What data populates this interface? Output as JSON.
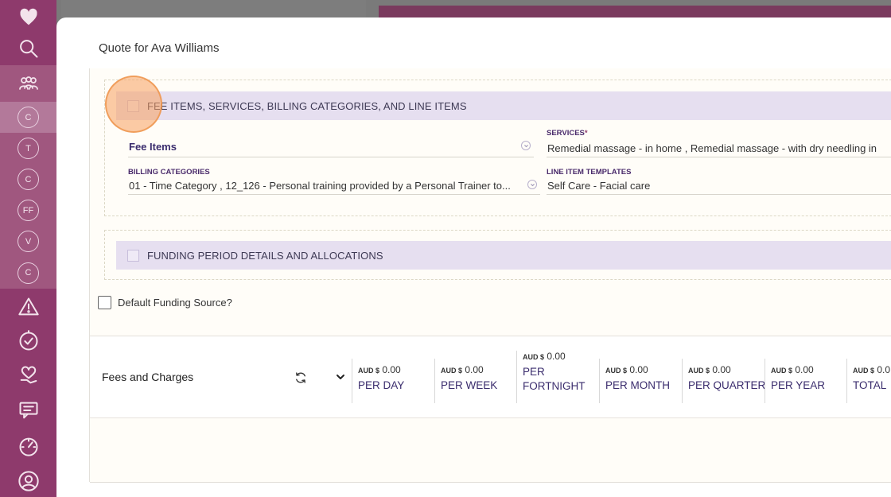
{
  "modal": {
    "title": "Quote for Ava Williams"
  },
  "sections": {
    "fee_items": {
      "title": "FEE ITEMS, SERVICES, BILLING CATEGORIES, AND LINE ITEMS",
      "fee_items_label": "Fee Items",
      "services_label": "SERVICES",
      "services_required_mark": "*",
      "services_value": "Remedial massage - in home , Remedial massage - with dry needling in",
      "billing_label": "BILLING CATEGORIES",
      "billing_value": "01 - Time Category , 12_126 - Personal training provided by a Personal Trainer to...",
      "line_item_label": "LINE ITEM TEMPLATES",
      "line_item_value": "Self Care - Facial care"
    },
    "funding": {
      "title": "FUNDING PERIOD DETAILS AND ALLOCATIONS"
    }
  },
  "default_funding_label": "Default Funding Source?",
  "fees": {
    "title": "Fees and Charges",
    "currency_prefix": "AUD $",
    "columns": [
      {
        "amount": "0.00",
        "period": "PER DAY"
      },
      {
        "amount": "0.00",
        "period": "PER WEEK"
      },
      {
        "amount": "0.00",
        "period": "PER FORTNIGHT"
      },
      {
        "amount": "0.00",
        "period": "PER MONTH"
      },
      {
        "amount": "0.00",
        "period": "PER QUARTER"
      },
      {
        "amount": "0.00",
        "period": "PER YEAR"
      },
      {
        "amount": "0.0",
        "period": "TOTAL"
      }
    ]
  },
  "rail": {
    "circles": [
      "C",
      "T",
      "C",
      "FF",
      "V",
      "C"
    ],
    "icons": [
      "heart-icon",
      "search-icon",
      "people-icon",
      "warning-icon",
      "clock-check-icon",
      "heart-hand-icon",
      "chat-icon",
      "gauge-icon",
      "user-icon"
    ]
  }
}
